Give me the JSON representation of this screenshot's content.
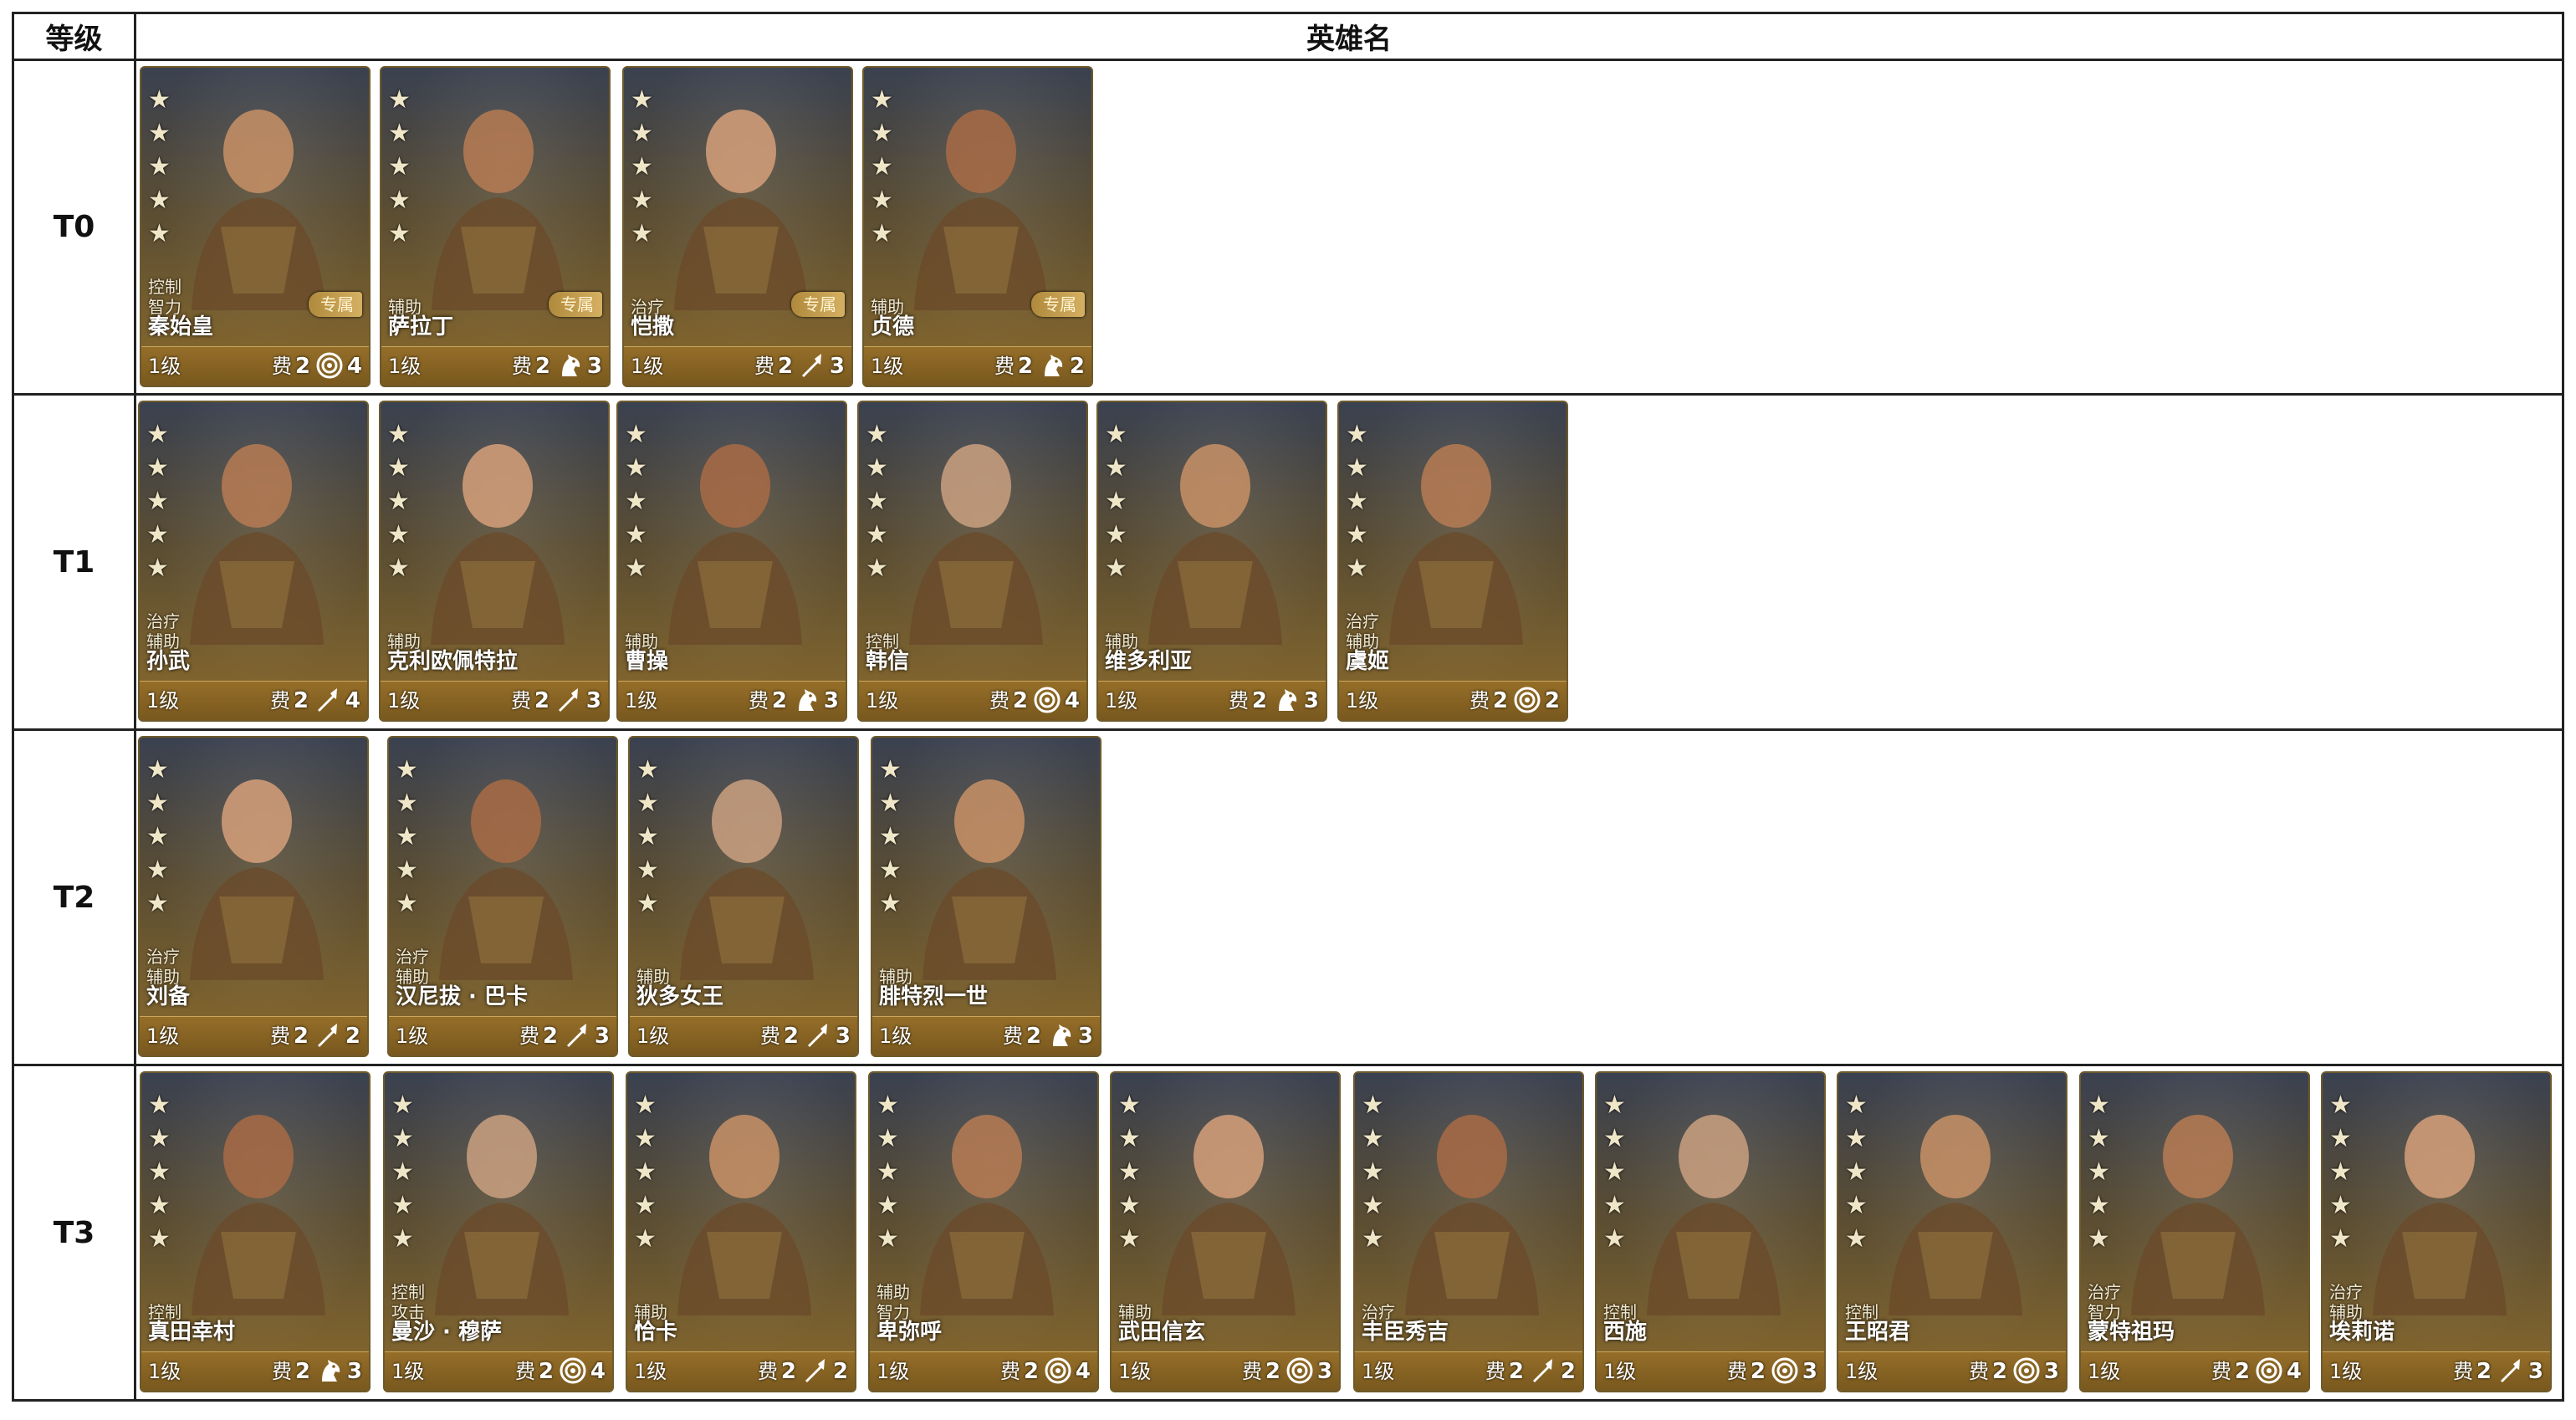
{
  "header": {
    "tier_label": "等级",
    "name_label": "英雄名"
  },
  "labels": {
    "cost": "费",
    "exclusive": "专属"
  },
  "colors": {
    "card_gold": "#8a6a2c",
    "grid_line": "#222222"
  },
  "tiers": [
    {
      "tier": "T0",
      "heroes": [
        {
          "name": "秦始皇",
          "roles": [
            "控制",
            "智力"
          ],
          "level": "1级",
          "cost": "2",
          "troop_icon": "target-icon",
          "troop_value": "4",
          "exclusive": true
        },
        {
          "name": "萨拉丁",
          "roles": [
            "辅助"
          ],
          "level": "1级",
          "cost": "2",
          "troop_icon": "horse-icon",
          "troop_value": "3",
          "exclusive": true
        },
        {
          "name": "恺撒",
          "roles": [
            "治疗"
          ],
          "level": "1级",
          "cost": "2",
          "troop_icon": "spear-icon",
          "troop_value": "3",
          "exclusive": true
        },
        {
          "name": "贞德",
          "roles": [
            "辅助"
          ],
          "level": "1级",
          "cost": "2",
          "troop_icon": "horse-icon",
          "troop_value": "2",
          "exclusive": true
        }
      ]
    },
    {
      "tier": "T1",
      "heroes": [
        {
          "name": "孙武",
          "roles": [
            "治疗",
            "辅助"
          ],
          "level": "1级",
          "cost": "2",
          "troop_icon": "spear-icon",
          "troop_value": "4",
          "exclusive": false
        },
        {
          "name": "克利欧佩特拉",
          "roles": [
            "辅助"
          ],
          "level": "1级",
          "cost": "2",
          "troop_icon": "spear-icon",
          "troop_value": "3",
          "exclusive": false
        },
        {
          "name": "曹操",
          "roles": [
            "辅助"
          ],
          "level": "1级",
          "cost": "2",
          "troop_icon": "horse-icon",
          "troop_value": "3",
          "exclusive": false
        },
        {
          "name": "韩信",
          "roles": [
            "控制"
          ],
          "level": "1级",
          "cost": "2",
          "troop_icon": "target-icon",
          "troop_value": "4",
          "exclusive": false
        },
        {
          "name": "维多利亚",
          "roles": [
            "辅助"
          ],
          "level": "1级",
          "cost": "2",
          "troop_icon": "horse-icon",
          "troop_value": "3",
          "exclusive": false
        },
        {
          "name": "虞姬",
          "roles": [
            "治疗",
            "辅助"
          ],
          "level": "1级",
          "cost": "2",
          "troop_icon": "target-icon",
          "troop_value": "2",
          "exclusive": false
        }
      ]
    },
    {
      "tier": "T2",
      "heroes": [
        {
          "name": "刘备",
          "roles": [
            "治疗",
            "辅助"
          ],
          "level": "1级",
          "cost": "2",
          "troop_icon": "spear-icon",
          "troop_value": "2",
          "exclusive": false
        },
        {
          "name": "汉尼拔 · 巴卡",
          "roles": [
            "治疗",
            "辅助"
          ],
          "level": "1级",
          "cost": "2",
          "troop_icon": "spear-icon",
          "troop_value": "3",
          "exclusive": false
        },
        {
          "name": "狄多女王",
          "roles": [
            "辅助"
          ],
          "level": "1级",
          "cost": "2",
          "troop_icon": "spear-icon",
          "troop_value": "3",
          "exclusive": false
        },
        {
          "name": "腓特烈一世",
          "roles": [
            "辅助"
          ],
          "level": "1级",
          "cost": "2",
          "troop_icon": "horse-icon",
          "troop_value": "3",
          "exclusive": false
        }
      ]
    },
    {
      "tier": "T3",
      "heroes": [
        {
          "name": "真田幸村",
          "roles": [
            "控制"
          ],
          "level": "1级",
          "cost": "2",
          "troop_icon": "horse-icon",
          "troop_value": "3",
          "exclusive": false
        },
        {
          "name": "曼沙 · 穆萨",
          "roles": [
            "控制",
            "攻击"
          ],
          "level": "1级",
          "cost": "2",
          "troop_icon": "target-icon",
          "troop_value": "4",
          "exclusive": false
        },
        {
          "name": "恰卡",
          "roles": [
            "辅助"
          ],
          "level": "1级",
          "cost": "2",
          "troop_icon": "spear-icon",
          "troop_value": "2",
          "exclusive": false
        },
        {
          "name": "卑弥呼",
          "roles": [
            "辅助",
            "智力"
          ],
          "level": "1级",
          "cost": "2",
          "troop_icon": "target-icon",
          "troop_value": "4",
          "exclusive": false
        },
        {
          "name": "武田信玄",
          "roles": [
            "辅助"
          ],
          "level": "1级",
          "cost": "2",
          "troop_icon": "target-icon",
          "troop_value": "3",
          "exclusive": false
        },
        {
          "name": "丰臣秀吉",
          "roles": [
            "治疗"
          ],
          "level": "1级",
          "cost": "2",
          "troop_icon": "spear-icon",
          "troop_value": "2",
          "exclusive": false
        },
        {
          "name": "西施",
          "roles": [
            "控制"
          ],
          "level": "1级",
          "cost": "2",
          "troop_icon": "target-icon",
          "troop_value": "3",
          "exclusive": false
        },
        {
          "name": "王昭君",
          "roles": [
            "控制"
          ],
          "level": "1级",
          "cost": "2",
          "troop_icon": "target-icon",
          "troop_value": "3",
          "exclusive": false
        },
        {
          "name": "蒙特祖玛",
          "roles": [
            "治疗",
            "智力"
          ],
          "level": "1级",
          "cost": "2",
          "troop_icon": "target-icon",
          "troop_value": "4",
          "exclusive": false
        },
        {
          "name": "埃莉诺",
          "roles": [
            "治疗",
            "辅助"
          ],
          "level": "1级",
          "cost": "2",
          "troop_icon": "spear-icon",
          "troop_value": "3",
          "exclusive": false
        }
      ]
    }
  ]
}
